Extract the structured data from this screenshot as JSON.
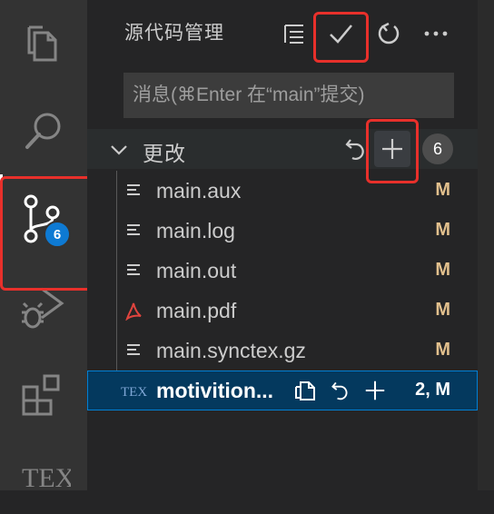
{
  "activity_bar": {
    "items": [
      {
        "name": "explorer-icon"
      },
      {
        "name": "search-icon"
      },
      {
        "name": "source-control-icon"
      },
      {
        "name": "run-debug-icon"
      },
      {
        "name": "extensions-icon"
      },
      {
        "name": "tex-icon"
      }
    ],
    "scm_badge": "6",
    "tex_label": "TEX"
  },
  "scm": {
    "title": "源代码管理",
    "actions": [
      "tree-view-icon",
      "check-icon",
      "refresh-icon",
      "more-icon"
    ],
    "message_placeholder": "消息(⌘Enter 在“main”提交)",
    "section": {
      "label": "更改",
      "count": "6",
      "actions": [
        "discard-all-icon",
        "stage-all-icon"
      ]
    },
    "files": [
      {
        "name": "main.aux",
        "status": "M",
        "icon": "file-lines-icon"
      },
      {
        "name": "main.log",
        "status": "M",
        "icon": "file-lines-icon"
      },
      {
        "name": "main.out",
        "status": "M",
        "icon": "file-lines-icon"
      },
      {
        "name": "main.pdf",
        "status": "M",
        "icon": "pdf-icon"
      },
      {
        "name": "main.synctex.gz",
        "status": "M",
        "icon": "file-lines-icon"
      },
      {
        "name": "motivition...",
        "status": "2, M",
        "icon": "tex-file-icon",
        "selected": true
      }
    ],
    "tex_file_icon_label": "TEX"
  },
  "colors": {
    "accent": "#0e7ad3",
    "highlight": "#e8302b",
    "modified": "#e2c08d",
    "selection": "#04395e"
  }
}
